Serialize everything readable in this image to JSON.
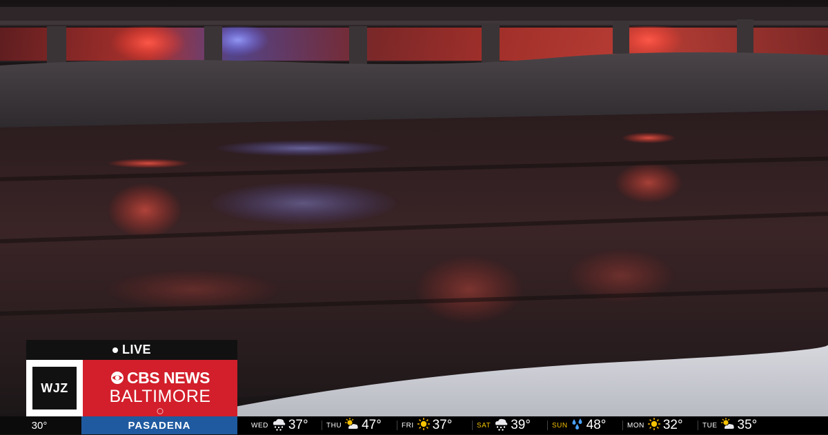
{
  "overlay": {
    "live_label": "LIVE",
    "station": "WJZ",
    "network": "CBS NEWS",
    "city": "BALTIMORE"
  },
  "ticker": {
    "current_temp": "30°",
    "location": "PASADENA",
    "forecast": [
      {
        "day": "WED",
        "icon": "snow-cloud-icon",
        "temp": "37°",
        "accent": false
      },
      {
        "day": "THU",
        "icon": "partly-sunny-icon",
        "temp": "47°",
        "accent": false
      },
      {
        "day": "FRI",
        "icon": "sun-icon",
        "temp": "37°",
        "accent": false
      },
      {
        "day": "SAT",
        "icon": "snow-cloud-icon",
        "temp": "39°",
        "accent": true
      },
      {
        "day": "SUN",
        "icon": "rain-icon",
        "temp": "48°",
        "accent": true
      },
      {
        "day": "MON",
        "icon": "sun-icon",
        "temp": "32°",
        "accent": false
      },
      {
        "day": "TUE",
        "icon": "partly-sunny-icon",
        "temp": "35°",
        "accent": false
      }
    ]
  },
  "colors": {
    "brand_red": "#d21f2b",
    "city_blue": "#1f5aa0",
    "day_accent": "#f2c200"
  }
}
